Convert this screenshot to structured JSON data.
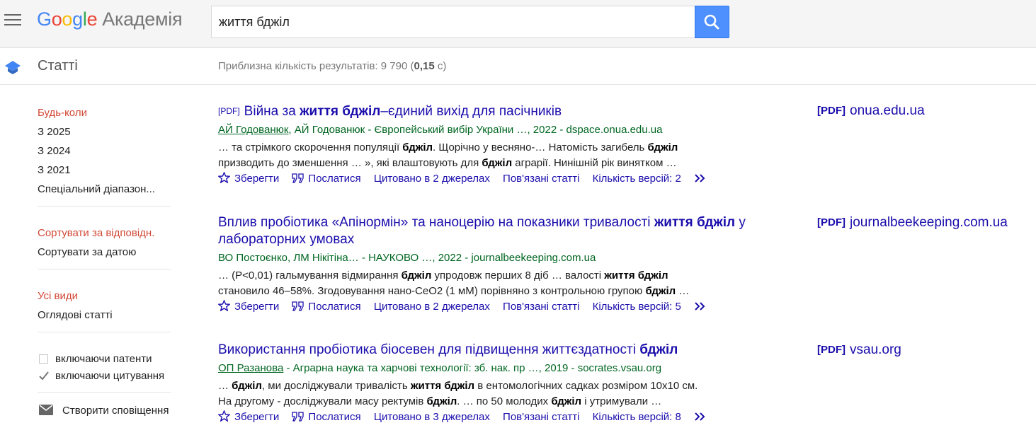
{
  "header": {
    "logo_google": "Google",
    "logo_sub": "Академія",
    "search_value": "життя бджіл"
  },
  "subheader": {
    "section_label": "Статті",
    "stats_prefix": "Приблизна кількість результатів: 9 790 (",
    "stats_time": "0,15",
    "stats_suffix": " с)"
  },
  "sidebar": {
    "time_filters": [
      {
        "label": "Будь-коли",
        "active": true
      },
      {
        "label": "З 2025",
        "active": false
      },
      {
        "label": "З 2024",
        "active": false
      },
      {
        "label": "З 2021",
        "active": false
      },
      {
        "label": "Спеціальний діапазон...",
        "active": false
      }
    ],
    "sort_options": [
      {
        "label": "Сортувати за відповідн.",
        "active": true
      },
      {
        "label": "Сортувати за датою",
        "active": false
      }
    ],
    "type_filters": [
      {
        "label": "Усі види",
        "active": true
      },
      {
        "label": "Оглядові статті",
        "active": false
      }
    ],
    "include_patents": {
      "label": "включаючи патенти",
      "checked": false
    },
    "include_citations": {
      "label": "включаючи цитування",
      "checked": true
    },
    "alert_label": "Створити сповіщення"
  },
  "actions": {
    "save": "Зберегти",
    "cite": "Послатися",
    "related": "Пов'язані статті"
  },
  "colors": {
    "link": "#1a0dab",
    "meta_green": "#006621",
    "active_red": "#d14836",
    "search_blue": "#4d90fe"
  },
  "results": [
    {
      "pdf_tag": "[PDF]",
      "title": "Війна за **життя бджіл**–єдиний вихід для пасічників",
      "author_link": "АЙ Годованюк",
      "meta_rest": ", АЙ Годованюк - Європейський вибір України …, 2022 - dspace.onua.edu.ua",
      "snippet": "… та стрімкого скорочення популяції **бджіл**. Щорічно у весняно-… Натомість загибель **бджіл** призводить до зменшення … », які влаштовують для **бджіл** аграрії. Нинішній рік винятком …",
      "cited_by": "Цитовано в 2 джерелах",
      "versions": "Кількість версій: 2",
      "side_tag": "[PDF]",
      "side_domain": "onua.edu.ua"
    },
    {
      "pdf_tag": "",
      "title": "Вплив пробіотика «Апінормін» та наноцерію на показники тривалості **життя бджіл** у лабораторних умовах",
      "author_link": "",
      "meta_rest": "ВО Постоєнко, ЛМ Нікітіна… - НАУКОВО …, 2022 - journalbeekeeping.com.ua",
      "snippet": "… (P<0,01) гальмування відмирання **бджіл** упродовж перших 8 діб … валості **життя бджіл** становило 46–58%. Згодовування нано-CeO2 (1 мМ) порівняно з контрольною групою **бджіл** …",
      "cited_by": "Цитовано в 2 джерелах",
      "versions": "Кількість версій: 5",
      "side_tag": "[PDF]",
      "side_domain": "journalbeekeeping.com.ua"
    },
    {
      "pdf_tag": "",
      "title": "Використання пробіотика біосевен для підвищення життєздатності **бджіл**",
      "author_link": "ОП Разанова",
      "meta_rest": " - Аграрна наука та харчові технології: зб. нак. пр …, 2019 - socrates.vsau.org",
      "snippet": "… **бджіл**, ми досліджували тривалість **життя бджіл** в ентомологічних садках розміром 10x10 см. На другому - досліджували масу ректумів **бджіл**. … по 50 молодих **бджіл** і утримували …",
      "cited_by": "Цитовано в 3 джерелах",
      "versions": "Кількість версій: 8",
      "side_tag": "[PDF]",
      "side_domain": "vsau.org"
    }
  ]
}
